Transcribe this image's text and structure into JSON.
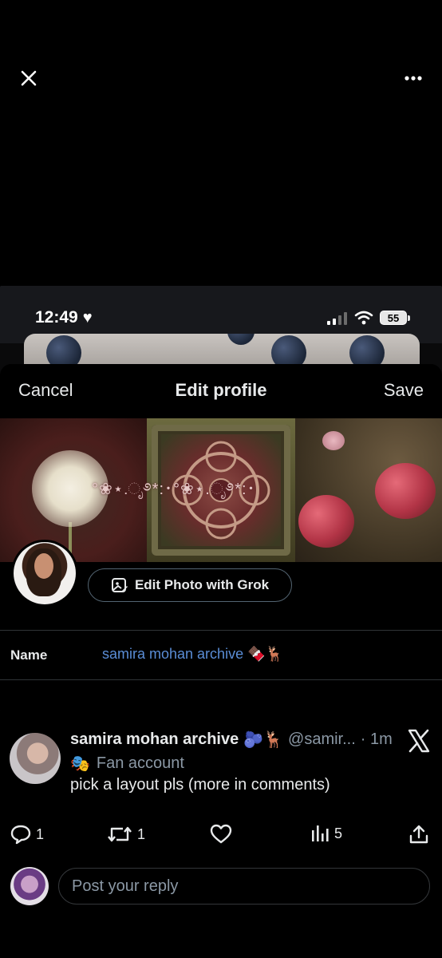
{
  "viewer": {
    "close_icon": "close-icon",
    "more_icon": "more-horizontal-icon"
  },
  "screenshot": {
    "status": {
      "time": "12:49",
      "heart": "♥",
      "battery": "55"
    },
    "nav": {
      "cancel": "Cancel",
      "title": "Edit profile",
      "save": "Save"
    },
    "banner": {
      "decoration_text": "°❀⋆.ೃ࿔*:･°❀⋆.ೃ࿔*:･"
    },
    "grok_button": "Edit Photo with Grok",
    "name_field": {
      "label": "Name",
      "value": "samira mohan archive 🍫🦌"
    }
  },
  "tweet": {
    "author": "samira mohan archive",
    "author_emoji": "🫐🦌",
    "handle": "@samir...",
    "time": "· 1m",
    "affiliation_emoji": "🎭",
    "affiliation": "Fan account",
    "text": "pick a layout pls (more in comments)",
    "actions": {
      "replies": "1",
      "retweets": "1",
      "likes": "",
      "views": "5"
    }
  },
  "reply_box": {
    "placeholder": "Post your reply"
  },
  "colors": {
    "background": "#000000",
    "link_blue": "#5a8dd6",
    "secondary_text": "#8b98a5",
    "divider": "#2f3336"
  }
}
